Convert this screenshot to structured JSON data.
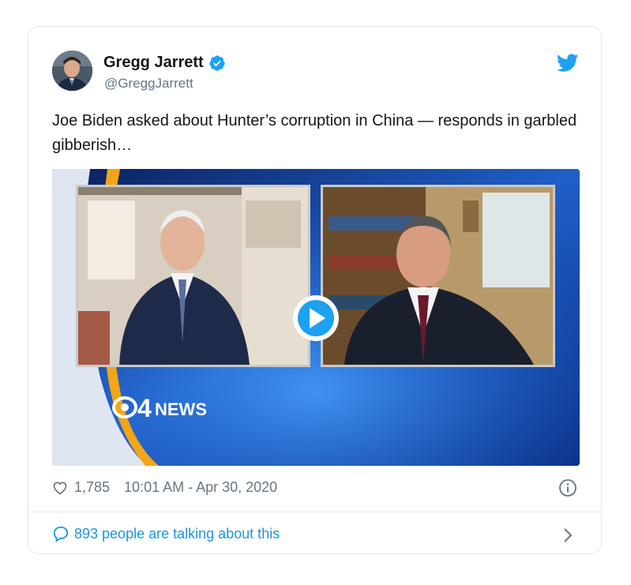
{
  "tweet": {
    "author_name": "Gregg Jarrett",
    "author_handle": "@GreggJarrett",
    "text": "Joe Biden asked about Hunter’s corruption in China — responds in garbled gibberish…",
    "likes": "1,785",
    "timestamp": "10:01 AM - Apr 30, 2020",
    "talking": "893 people are talking about this"
  },
  "media": {
    "network_number": "4",
    "network_text": "NEWS"
  },
  "colors": {
    "accent": "#1da1f2",
    "link": "#1b95e0",
    "muted": "#657786",
    "border": "#e1e8ed"
  },
  "icons": [
    "twitter-bird-icon",
    "verified-badge-icon",
    "heart-icon",
    "info-icon",
    "speech-bubble-icon",
    "chevron-right-icon",
    "play-icon"
  ]
}
